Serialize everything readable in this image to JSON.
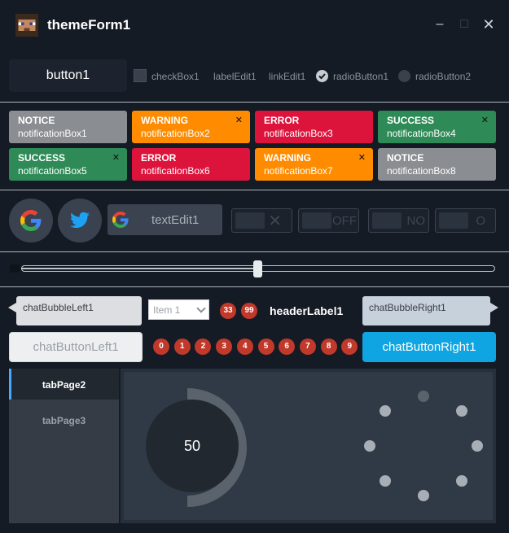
{
  "window": {
    "title": "themeForm1",
    "minimize_glyph": "–",
    "maximize_glyph": "□",
    "close_glyph": "✕"
  },
  "row1": {
    "button1": "button1",
    "checkbox": "checkBox1",
    "label_edit": "labelEdit1",
    "link_edit": "linkEdit1",
    "radio1": "radioButton1",
    "radio2": "radioButton2"
  },
  "notifications": [
    {
      "title": "NOTICE",
      "text": "notificationBox1",
      "color": "#8a8d91",
      "close": ""
    },
    {
      "title": "WARNING",
      "text": "notificationBox2",
      "color": "#ff8c00",
      "close": "✕"
    },
    {
      "title": "ERROR",
      "text": "notificationBox3",
      "color": "#dc143c",
      "close": ""
    },
    {
      "title": "SUCCESS",
      "text": "notificationBox4",
      "color": "#2e8b57",
      "close": "✕"
    },
    {
      "title": "SUCCESS",
      "text": "notificationBox5",
      "color": "#2e8b57",
      "close": "✕"
    },
    {
      "title": "ERROR",
      "text": "notificationBox6",
      "color": "#dc143c",
      "close": ""
    },
    {
      "title": "WARNING",
      "text": "notificationBox7",
      "color": "#ff8c00",
      "close": "✕"
    },
    {
      "title": "NOTICE",
      "text": "notificationBox8",
      "color": "#8a8d91",
      "close": ""
    }
  ],
  "inputs": {
    "text_edit": "textEdit1",
    "toggle1": "✕",
    "toggle2": "OFF",
    "toggle3": "NO",
    "toggle4": "O"
  },
  "slider": {
    "value_fraction": 0.5
  },
  "chat": {
    "bubble_left": "chatBubbleLeft1",
    "bubble_right": "chatBubbleRight1",
    "combo_value": "Item 1",
    "header_label": "headerLabel1",
    "badges_top": [
      "33",
      "99"
    ],
    "badges_bottom": [
      "0",
      "1",
      "2",
      "3",
      "4",
      "5",
      "6",
      "7",
      "8",
      "9"
    ],
    "button_left": "chatButtonLeft1",
    "button_right": "chatButtonRight1"
  },
  "tabs": {
    "items": [
      "tabPage2",
      "tabPage3"
    ],
    "knob_value": "50"
  },
  "colors": {
    "accent": "#0ea5e2",
    "badge": "#c0392b",
    "background": "#151b24"
  }
}
